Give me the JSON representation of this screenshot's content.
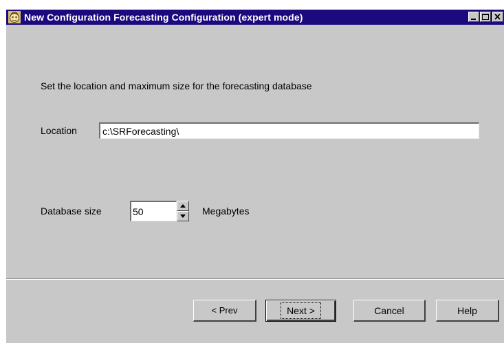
{
  "window": {
    "title": "New Configuration Forecasting Configuration (expert mode)",
    "app_icon": "configuration-app-icon",
    "controls": [
      "minimize-icon",
      "maximize-icon",
      "close-icon"
    ]
  },
  "content": {
    "prompt": "Set the location and maximum size for the forecasting database",
    "location": {
      "label": "Location",
      "value": "c:\\SRForecasting\\"
    },
    "database_size": {
      "label": "Database size",
      "value": "50",
      "unit": "Megabytes"
    }
  },
  "buttons": {
    "prev": "< Prev",
    "next": "Next >",
    "cancel": "Cancel",
    "help": "Help"
  },
  "colors": {
    "titlebar": "#1b0a7e",
    "dialog_face": "#c8c8c8"
  }
}
